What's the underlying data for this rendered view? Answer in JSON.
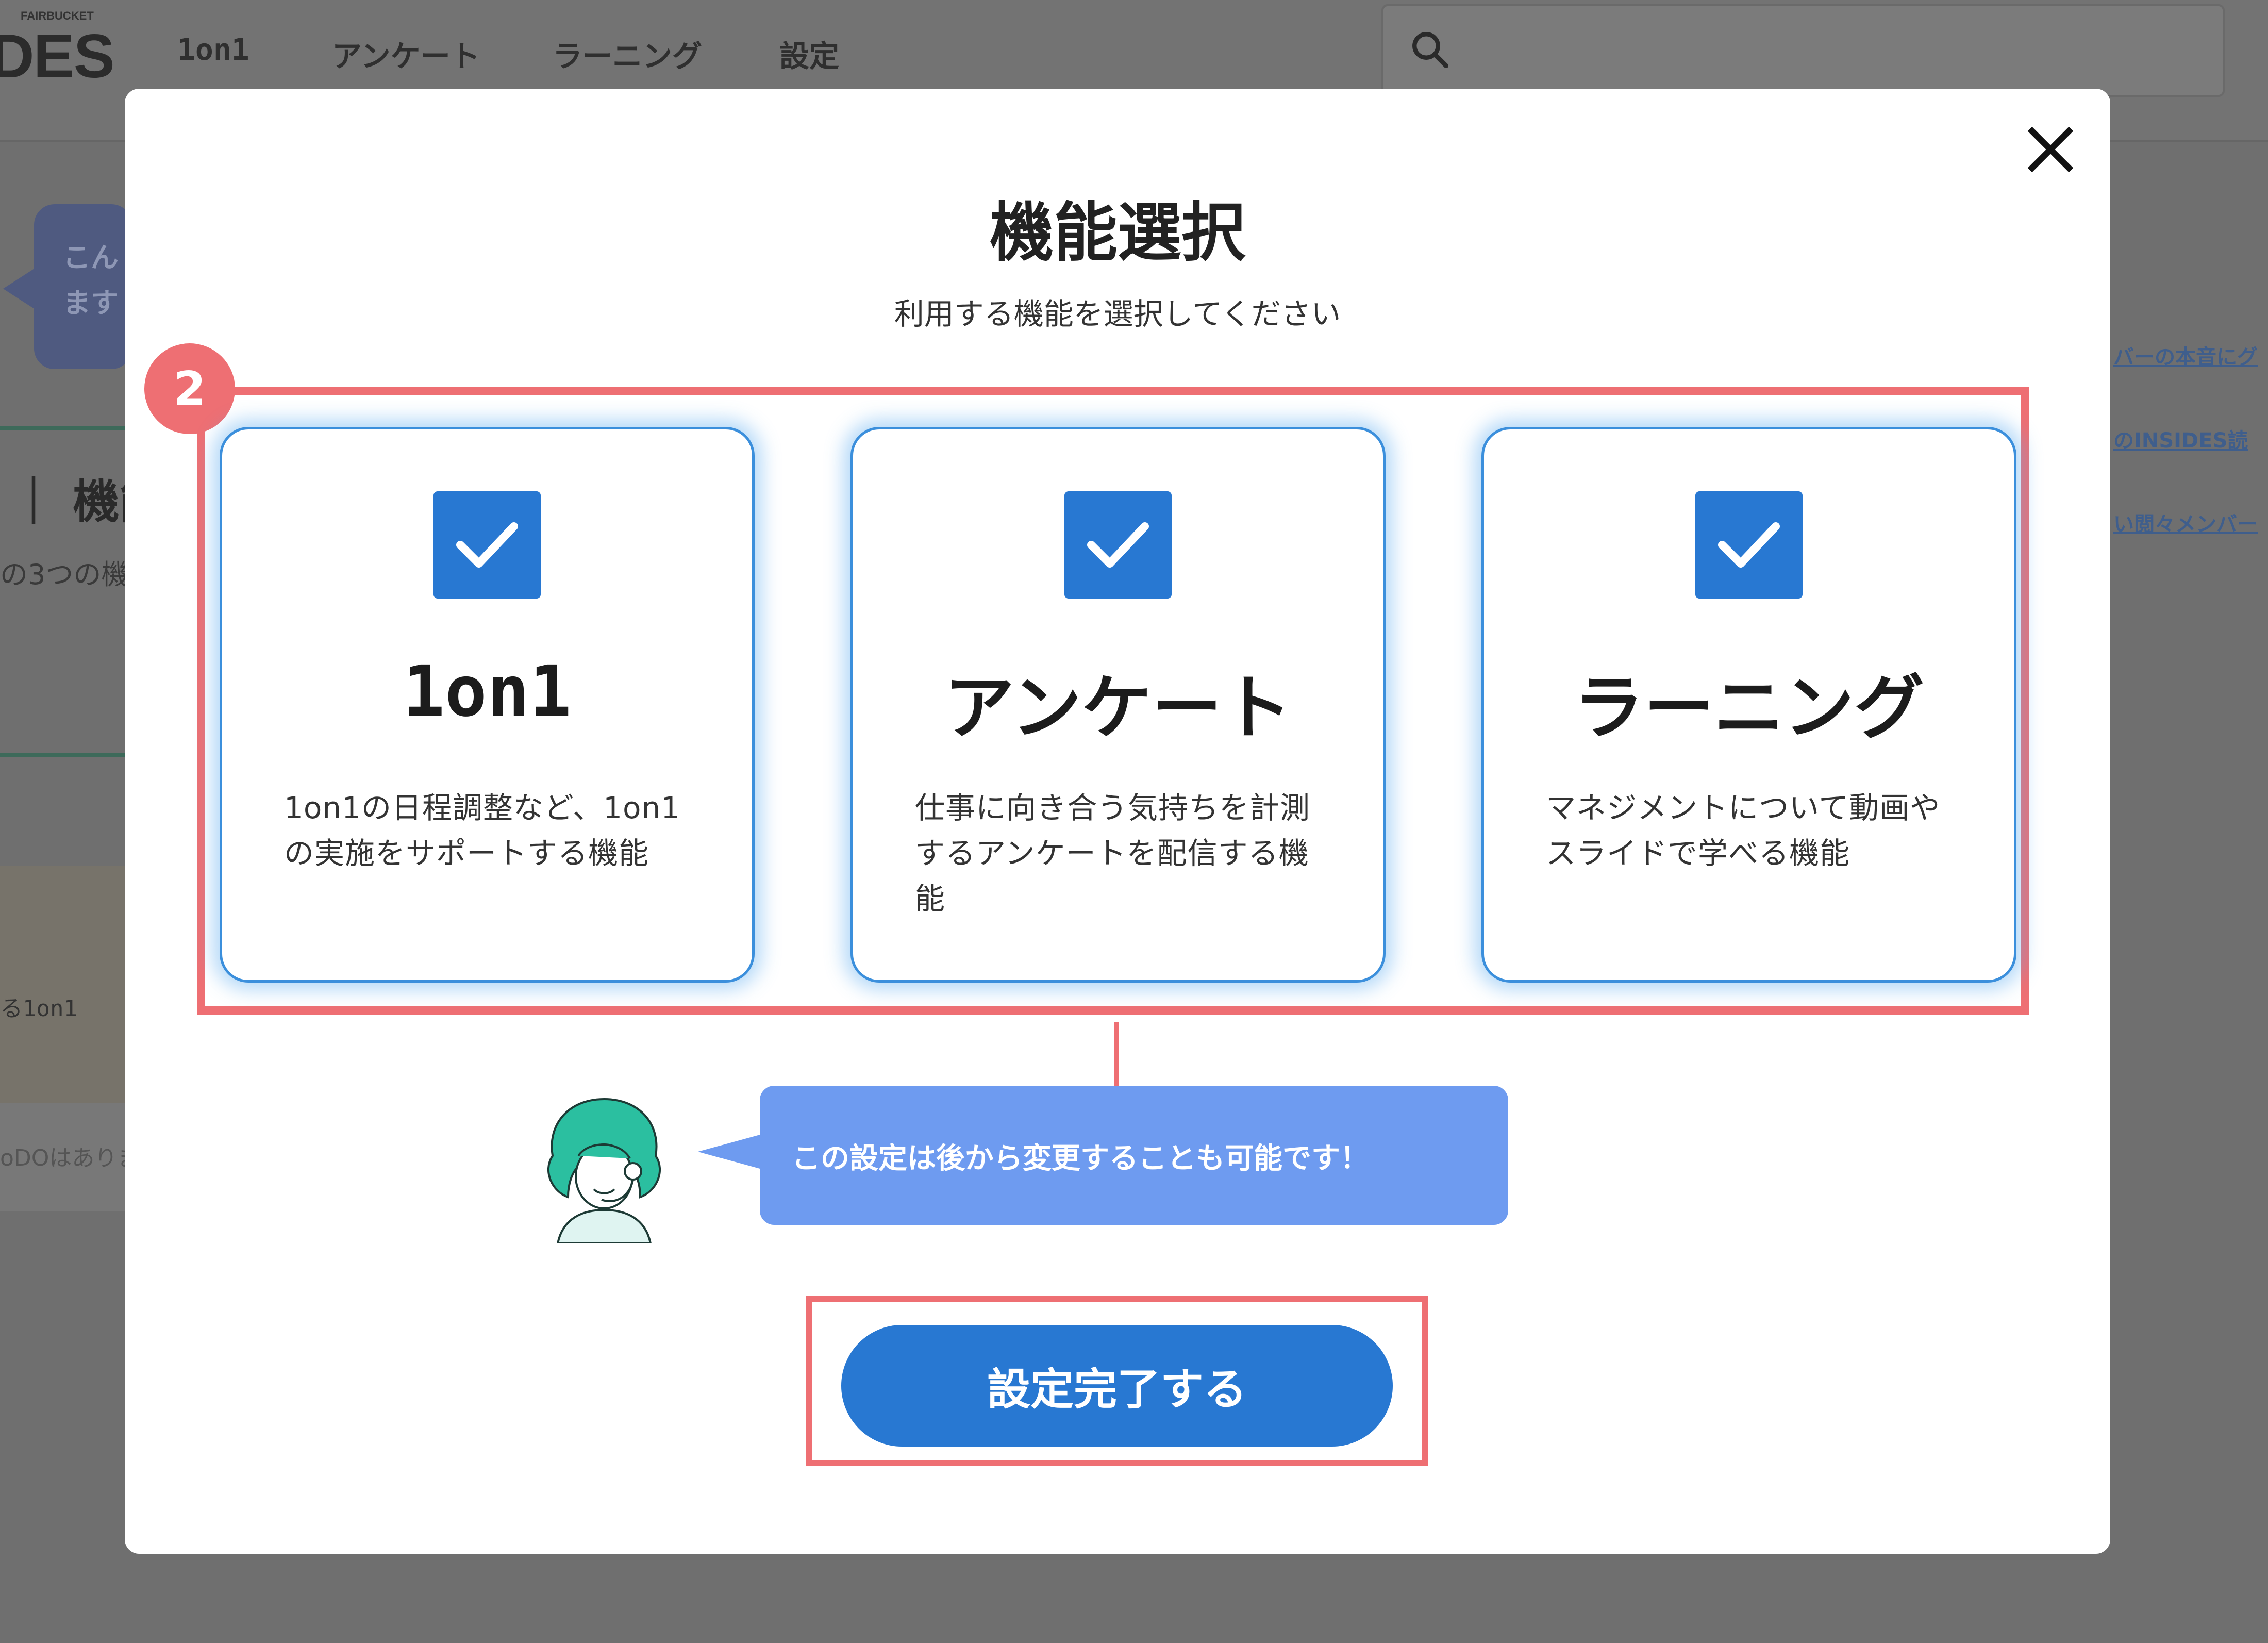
{
  "background": {
    "logo_partial": "DES",
    "logo_small": "FAIRBUCKET",
    "nav": [
      "1on1",
      "アンケート",
      "ラーニング",
      "設定"
    ],
    "bubble_text": [
      "こん",
      "ます"
    ],
    "section_title": "｜ 機能",
    "section_text": "の3つの機",
    "card_text": "る1on1",
    "todo_text": "oDOはありま",
    "right_links": [
      "バーの本音にグ",
      "のINSIDES読",
      "い閲々メンバー"
    ]
  },
  "modal": {
    "close_icon": "close-icon",
    "title": "機能選択",
    "subtitle": "利用する機能を選択してください",
    "step_badge": "2",
    "features": [
      {
        "title": "1on1",
        "desc_lines": [
          "1on1の日程調整など、1on1",
          "の実施をサポートする機能"
        ],
        "checked": true
      },
      {
        "title": "アンケート",
        "desc_lines": [
          "仕事に向き合う気持ちを計測",
          "するアンケートを配信する機",
          "能"
        ],
        "checked": true
      },
      {
        "title": "ラーニング",
        "desc_lines": [
          "マネジメントについて動画や",
          "スライドで学べる機能"
        ],
        "checked": true
      }
    ],
    "info_message": "この設定は後から変更することも可能です！",
    "submit_label": "設定完了する"
  },
  "colors": {
    "accent": "#2878d2",
    "highlight": "#ee6f73",
    "bubble": "#6e9bf0",
    "overlay": "#6f6f6f"
  }
}
